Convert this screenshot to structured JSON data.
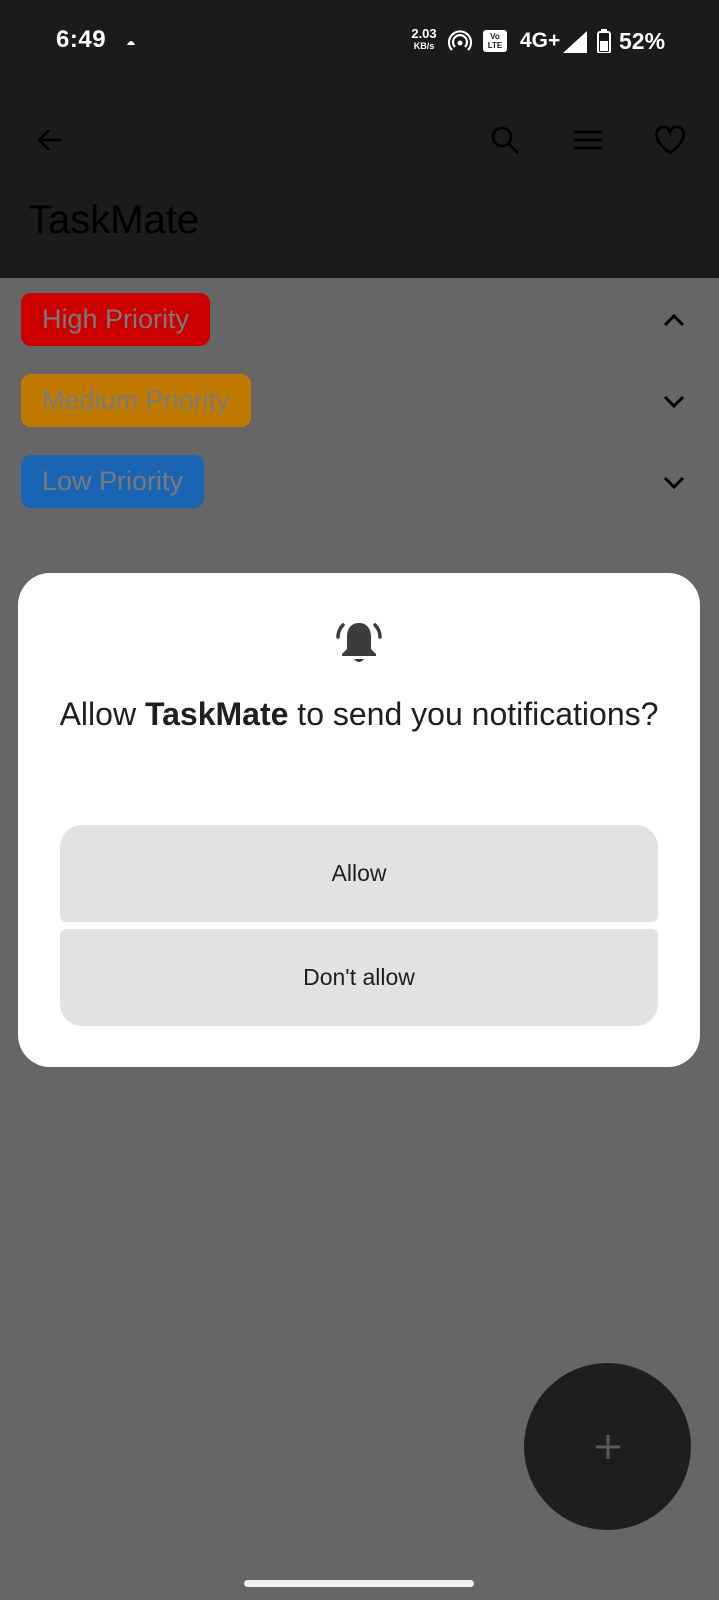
{
  "status_bar": {
    "time": "6:49",
    "speed_value": "2.03",
    "speed_unit": "KB/s",
    "volte_top": "Vo",
    "volte_bottom": "LTE",
    "network": "4G+",
    "battery": "52%",
    "icons": [
      "hotspot-icon",
      "volte-icon",
      "signal-icon",
      "battery-icon"
    ]
  },
  "app_bar": {
    "title": "TaskMate",
    "icons": [
      "back-arrow-icon",
      "search-icon",
      "menu-icon",
      "heart-icon"
    ]
  },
  "priorities": [
    {
      "label": "High Priority",
      "color": "#cc0000",
      "expanded": true
    },
    {
      "label": "Medium Priority",
      "color": "#c07a00",
      "expanded": false
    },
    {
      "label": "Low Priority",
      "color": "#1a64b4",
      "expanded": false
    }
  ],
  "dialog": {
    "icon": "bell-icon",
    "title_prefix": "Allow ",
    "title_app": "TaskMate",
    "title_suffix": " to send you notifications?",
    "allow_label": "Allow",
    "deny_label": "Don't allow"
  },
  "fab": {
    "icon": "plus-icon"
  },
  "colors": {
    "scrim": "#666666",
    "app_bar": "#1b1b1b",
    "dialog_bg": "#ffffff",
    "button_bg": "#e2e2e2"
  }
}
